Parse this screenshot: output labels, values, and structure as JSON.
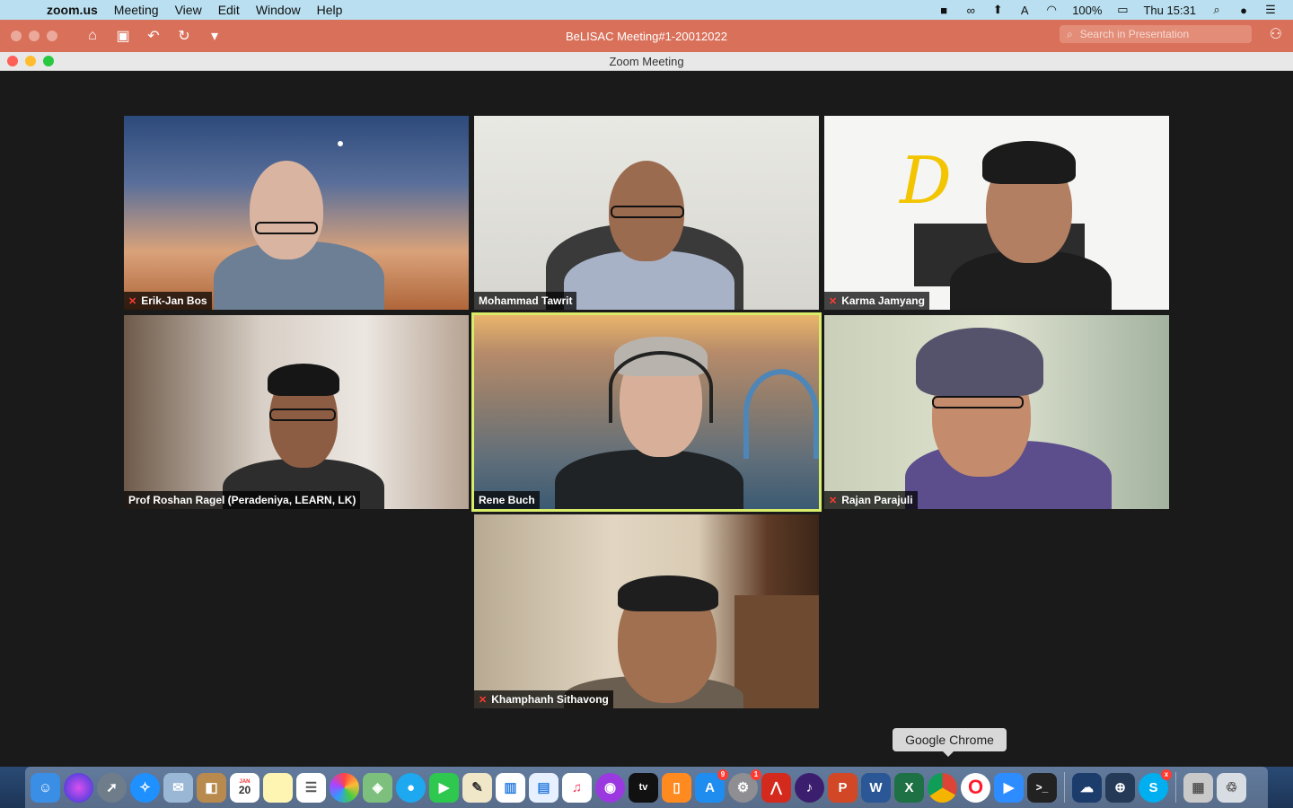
{
  "menubar": {
    "apple": "",
    "app_name": "zoom.us",
    "items": [
      "Meeting",
      "View",
      "Edit",
      "Window",
      "Help"
    ],
    "battery": "100%",
    "clock": "Thu 15:31"
  },
  "ppt": {
    "document_title": "BeLISAC Meeting#1-20012022",
    "search_placeholder": "Search in Presentation"
  },
  "zoom": {
    "window_title": "Zoom Meeting",
    "participants": [
      {
        "name": "Erik-Jan Bos",
        "muted": true
      },
      {
        "name": "Mohammad Tawrit",
        "muted": false
      },
      {
        "name": "Karma Jamyang",
        "muted": true
      },
      {
        "name": "Prof Roshan Ragel (Peradeniya, LEARN, LK)",
        "muted": false
      },
      {
        "name": "Rene Buch",
        "muted": false,
        "active_speaker": true
      },
      {
        "name": "Rajan Parajuli",
        "muted": true
      },
      {
        "name": "Khamphanh Sithavong",
        "muted": true
      }
    ]
  },
  "dock": {
    "tooltip": "Google Chrome",
    "badges": {
      "appstore": "9",
      "settings": "1",
      "skype": "x"
    },
    "calendar_month": "JAN",
    "calendar_day": "20",
    "appletv": "tv"
  }
}
